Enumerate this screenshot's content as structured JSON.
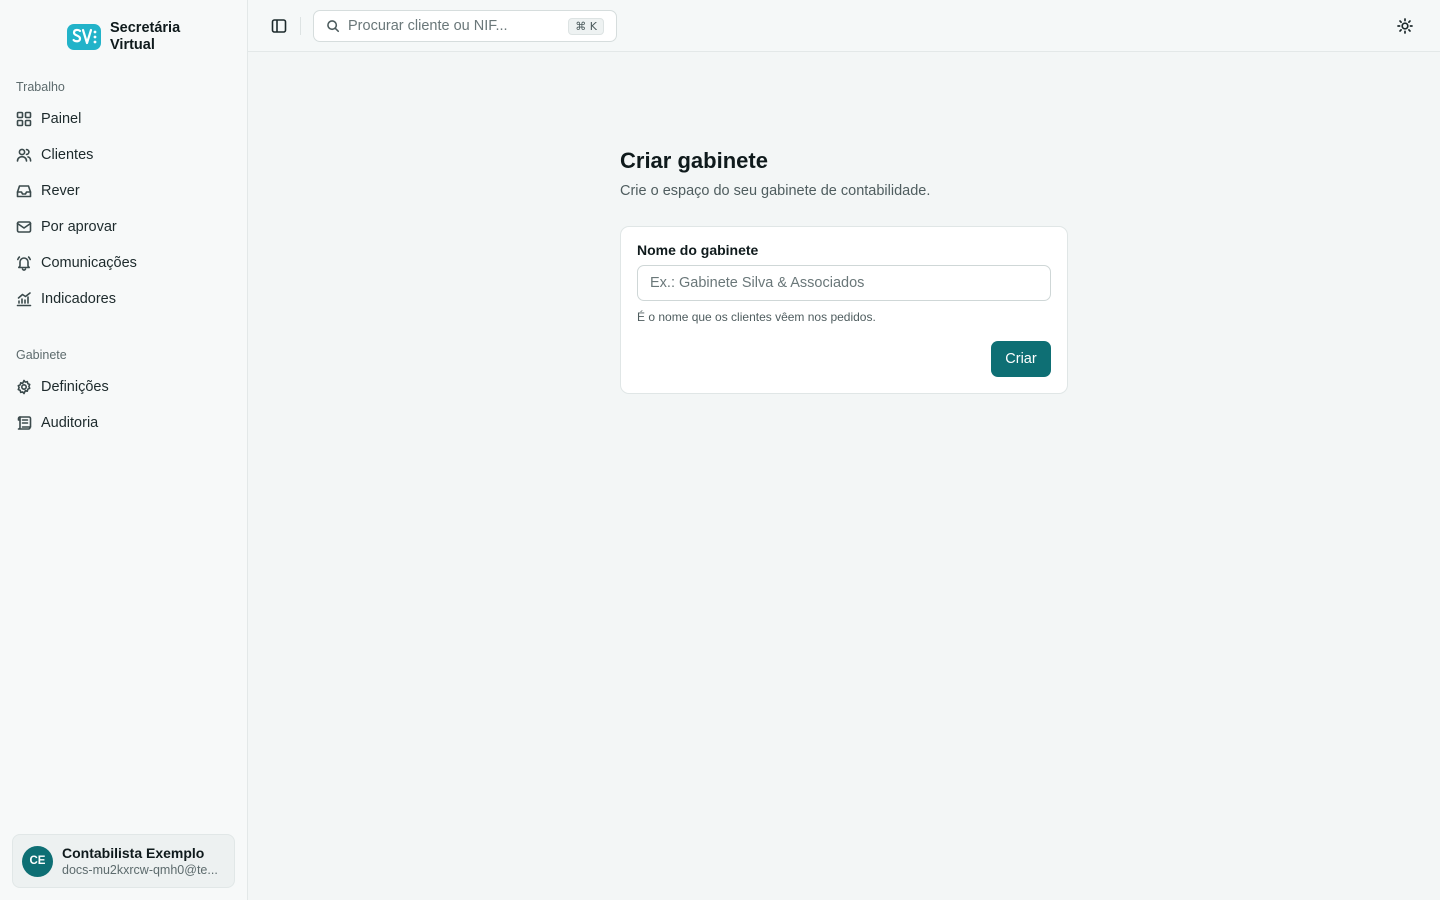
{
  "brand": {
    "name_line1": "Secretária",
    "name_line2": "Virtual"
  },
  "sidebar": {
    "sections": [
      {
        "label": "Trabalho"
      },
      {
        "label": "Gabinete"
      }
    ],
    "work_items": [
      {
        "label": "Painel",
        "icon": "grid-icon"
      },
      {
        "label": "Clientes",
        "icon": "users-icon"
      },
      {
        "label": "Rever",
        "icon": "inbox-icon"
      },
      {
        "label": "Por aprovar",
        "icon": "mail-icon"
      },
      {
        "label": "Comunicações",
        "icon": "bell-icon"
      },
      {
        "label": "Indicadores",
        "icon": "chart-icon"
      }
    ],
    "office_items": [
      {
        "label": "Definições",
        "icon": "gear-icon"
      },
      {
        "label": "Auditoria",
        "icon": "scroll-icon"
      }
    ]
  },
  "user": {
    "initials": "CE",
    "name": "Contabilista Exemplo",
    "email": "docs-mu2kxrcw-qmh0@te..."
  },
  "topbar": {
    "search_placeholder": "Procurar cliente ou NIF...",
    "search_shortcut": "⌘ K"
  },
  "main": {
    "title": "Criar gabinete",
    "subtitle": "Crie o espaço do seu gabinete de contabilidade.",
    "form": {
      "field_label": "Nome do gabinete",
      "field_placeholder": "Ex.: Gabinete Silva & Associados",
      "field_value": "",
      "field_hint": "É o nome que os clientes vêem nos pedidos.",
      "submit_label": "Criar"
    }
  },
  "colors": {
    "accent": "#0e6f74",
    "background": "#f3f6f6"
  }
}
